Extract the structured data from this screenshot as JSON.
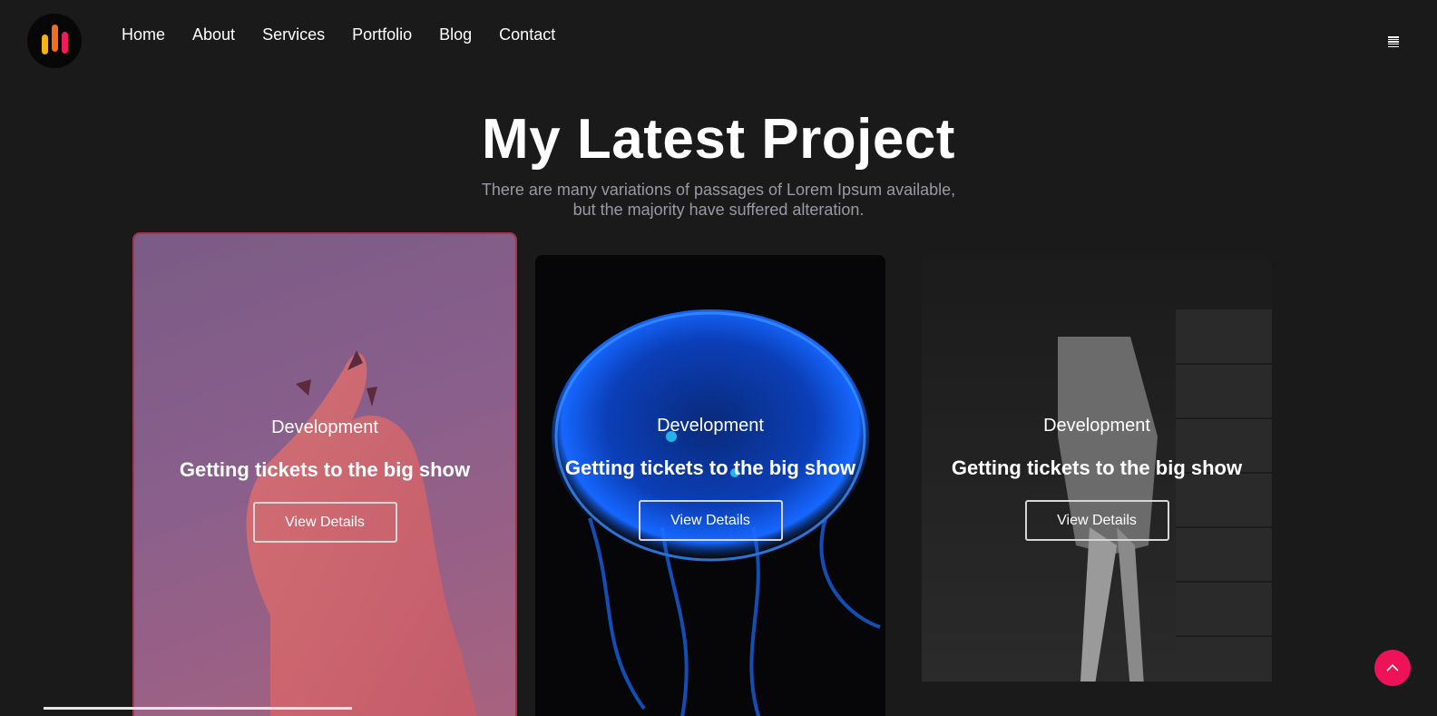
{
  "nav": {
    "items": [
      "Home",
      "About",
      "Services",
      "Portfolio",
      "Blog",
      "Contact"
    ]
  },
  "hero": {
    "title": "My Latest Project",
    "subtitle_line1": "There are many variations of passages of Lorem Ipsum available,",
    "subtitle_line2": "but the majority have suffered alteration."
  },
  "cards": [
    {
      "category": "Development",
      "title": "Getting tickets to the big show",
      "button": "View Details"
    },
    {
      "category": "Development",
      "title": "Getting tickets to the big show",
      "button": "View Details"
    },
    {
      "category": "Development",
      "title": "Getting tickets to the big show",
      "button": "View Details"
    }
  ],
  "icons": {
    "logo": "brand-logo-icon",
    "menu": "hamburger-menu-icon",
    "scroll_top": "chevron-up-icon"
  },
  "colors": {
    "background": "#1a1a1a",
    "accent": "#ee1259",
    "muted_text": "#9a9aa6"
  }
}
